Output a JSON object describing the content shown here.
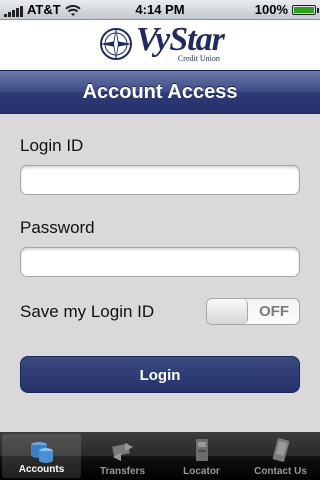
{
  "status_bar": {
    "carrier": "AT&T",
    "time": "4:14 PM",
    "battery": "100%"
  },
  "brand": {
    "name": "VyStar",
    "subtitle": "Credit Union"
  },
  "title": "Account Access",
  "form": {
    "login_id_label": "Login ID",
    "login_id_value": "",
    "password_label": "Password",
    "password_value": "",
    "save_label": "Save my Login ID",
    "save_toggle": "OFF",
    "login_button": "Login"
  },
  "tabs": [
    {
      "label": "Accounts",
      "icon": "accounts-icon",
      "active": true
    },
    {
      "label": "Transfers",
      "icon": "transfers-icon",
      "active": false
    },
    {
      "label": "Locator",
      "icon": "locator-icon",
      "active": false
    },
    {
      "label": "Contact Us",
      "icon": "contact-icon",
      "active": false
    }
  ]
}
